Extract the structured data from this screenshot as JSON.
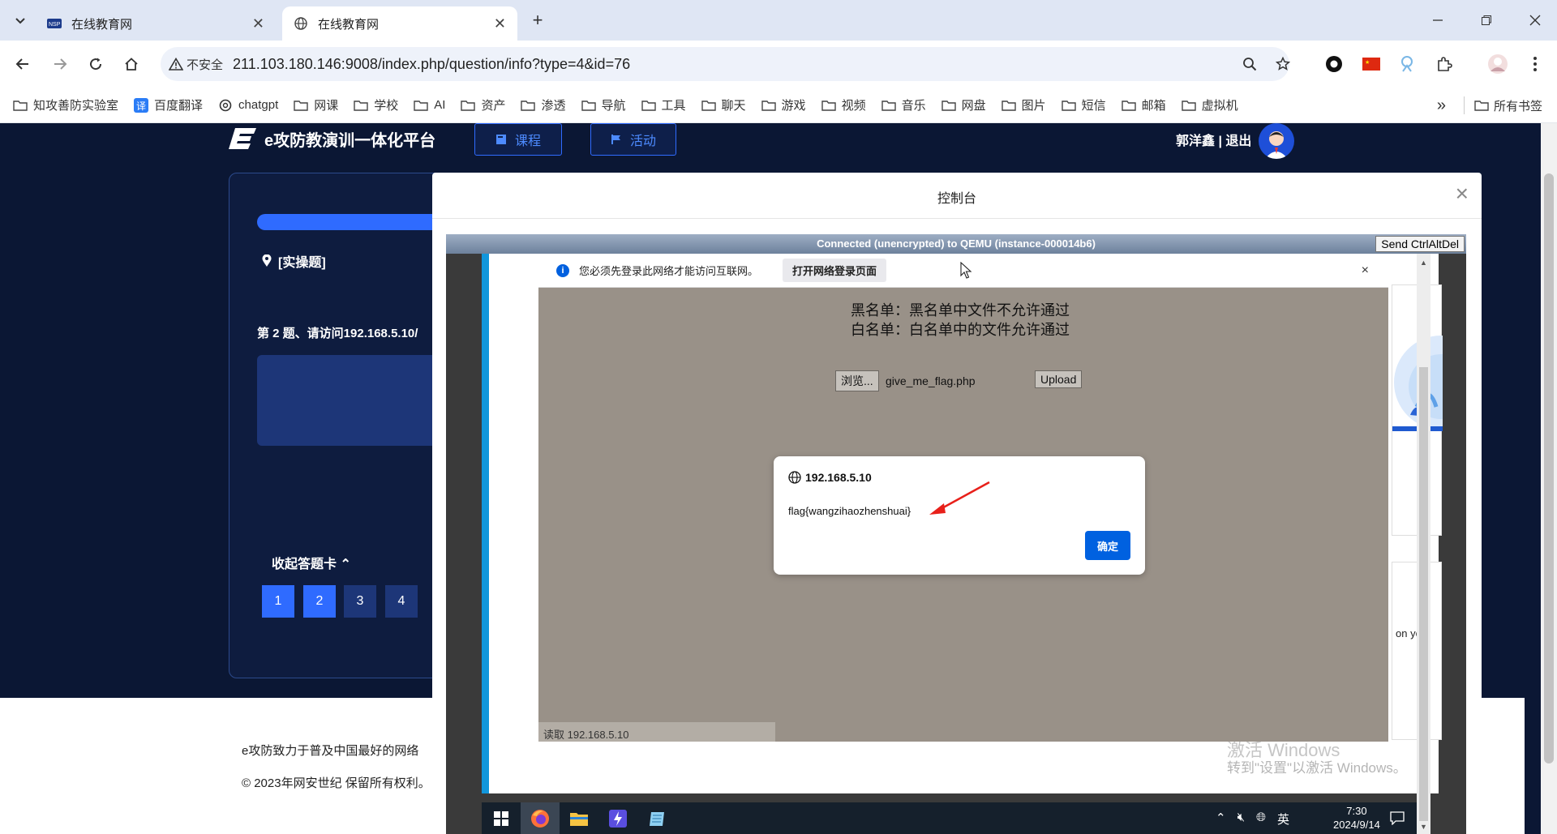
{
  "browser": {
    "tabs": [
      {
        "title": "在线教育网"
      },
      {
        "title": "在线教育网"
      }
    ],
    "address": {
      "security_label": "不安全",
      "url": "211.103.180.146:9008/index.php/question/info?type=4&id=76"
    },
    "bookmarks": [
      "知攻善防实验室",
      "百度翻译",
      "chatgpt",
      "网课",
      "学校",
      "AI",
      "资产",
      "渗透",
      "导航",
      "工具",
      "聊天",
      "游戏",
      "视频",
      "音乐",
      "网盘",
      "图片",
      "短信",
      "邮箱",
      "虚拟机"
    ],
    "bookmarks_overflow": "»",
    "all_bookmarks": "所有书签"
  },
  "site": {
    "logo_text": "e攻防教演训一体化平台",
    "nav": [
      {
        "label": "课程",
        "icon": "book-icon"
      },
      {
        "label": "活动",
        "icon": "flag-icon"
      }
    ],
    "user_text": "郭洋鑫 | 退出",
    "question_type": "[实操题]",
    "question_text": "第 2 题、请访问192.168.5.10/",
    "card_toggle": "收起答题卡 ⌃",
    "question_numbers": [
      "1",
      "2",
      "3",
      "4"
    ],
    "active_questions": [
      "1",
      "2"
    ],
    "footer": {
      "line1": "e攻防致力于普及中国最好的网络",
      "line2": "© 2023年网安世纪 保留所有权利。"
    }
  },
  "console": {
    "title": "控制台",
    "close": "×",
    "vnc_status": "Connected (unencrypted) to QEMU (instance-000014b6)",
    "send_cad": "Send CtrlAltDel",
    "notification": {
      "text": "您必须先登录此网络才能访问互联网。",
      "button": "打开网络登录页面",
      "close": "×"
    },
    "rules": [
      "黑名单：黑名单中文件不允许通过",
      "白名单：白名单中的文件允许通过"
    ],
    "browse_button": "浏览...",
    "file_name": "give_me_flag.php",
    "upload_button": "Upload",
    "status_text": "读取 192.168.5.10",
    "alert": {
      "host": "192.168.5.10",
      "message": "flag{wangzihaozhenshuai}",
      "ok": "确定"
    },
    "side_text": "on you",
    "watermark": {
      "line1": "激活 Windows",
      "line2": "转到\"设置\"以激活 Windows。"
    },
    "taskbar": {
      "clock_time": "7:30",
      "clock_date": "2024/9/14",
      "ime": "英"
    }
  },
  "colors": {
    "accent": "#2f6bff",
    "page_bg": "#0b1734",
    "ok_button": "#0061e0",
    "arrow": "#e8201a"
  }
}
